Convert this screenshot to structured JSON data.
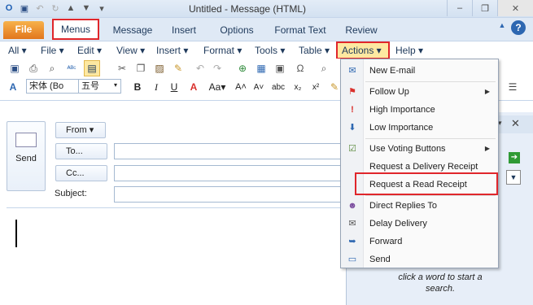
{
  "window": {
    "title": "Untitled  -  Message (HTML)",
    "controls": {
      "minimize": "–",
      "restore": "❐",
      "close": "✕"
    }
  },
  "tabs": [
    "File",
    "Menus",
    "Message",
    "Insert",
    "Options",
    "Format Text",
    "Review"
  ],
  "menubar": {
    "items": [
      {
        "label": "All ▾"
      },
      {
        "label": "File ▾"
      },
      {
        "label": "Edit ▾"
      },
      {
        "label": "View ▾"
      },
      {
        "label": "Insert ▾"
      },
      {
        "label": "Format ▾"
      },
      {
        "label": "Tools ▾"
      },
      {
        "label": "Table ▾"
      },
      {
        "label": "Actions ▾"
      },
      {
        "label": "Help ▾"
      }
    ]
  },
  "toolbar": {
    "font_name": "宋体 (Bo",
    "font_size": "五号",
    "bold": "B",
    "italic": "I",
    "underline": "U"
  },
  "compose": {
    "send_label": "Send",
    "from_label": "From ▾",
    "to_label": "To...",
    "cc_label": "Cc...",
    "subject_label": "Subject:",
    "to_value": "",
    "cc_value": "",
    "subject_value": ""
  },
  "right_pane": {
    "hint": "click a word to start a search."
  },
  "actions_menu": {
    "items": [
      {
        "label": "New E-mail",
        "icon": "new-email-icon",
        "glyph": "✉",
        "color": "#2d67b1"
      },
      {
        "label": "Follow Up",
        "icon": "flag-icon",
        "glyph": "⚑",
        "color": "#d9302c",
        "submenu": true
      },
      {
        "label": "High Importance",
        "icon": "high-importance-icon",
        "glyph": "!",
        "color": "#d9302c"
      },
      {
        "label": "Low Importance",
        "icon": "low-importance-icon",
        "glyph": "⬇",
        "color": "#2d67b1"
      },
      {
        "label": "Use Voting Buttons",
        "icon": "voting-icon",
        "glyph": "☑",
        "color": "#5a8a3c",
        "submenu": true
      },
      {
        "label": "Request a Delivery Receipt",
        "icon": "",
        "glyph": "",
        "color": "#000"
      },
      {
        "label": "Request a Read Receipt",
        "icon": "",
        "glyph": "",
        "color": "#000"
      },
      {
        "label": "Direct Replies To",
        "icon": "direct-replies-icon",
        "glyph": "☻",
        "color": "#7a4c9e"
      },
      {
        "label": "Delay Delivery",
        "icon": "delay-delivery-icon",
        "glyph": "✉",
        "color": "#555"
      },
      {
        "label": "Forward",
        "icon": "forward-icon",
        "glyph": "➥",
        "color": "#2d67b1"
      },
      {
        "label": "Send",
        "icon": "send-icon",
        "glyph": "▭",
        "color": "#2d67b1"
      }
    ]
  }
}
